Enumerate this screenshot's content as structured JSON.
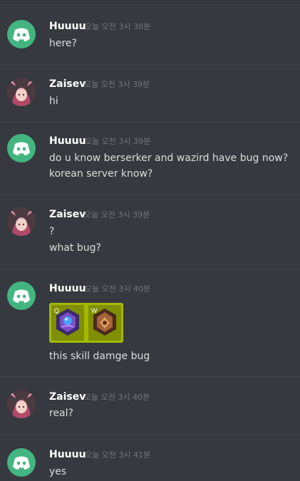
{
  "messages": [
    {
      "author": "Huuuu",
      "avatar": "discord-logo",
      "time": "오늘 오전 3시 38분",
      "lines": [
        "here?"
      ]
    },
    {
      "author": "Zaisev",
      "avatar": "character-portrait",
      "time": "오늘 오전 3시 39분",
      "lines": [
        "hi"
      ]
    },
    {
      "author": "Huuuu",
      "avatar": "discord-logo",
      "time": "오늘 오전 3시 39분",
      "lines": [
        "do u know berserker and wazird have bug now?",
        "korean server know?"
      ]
    },
    {
      "author": "Zaisev",
      "avatar": "character-portrait",
      "time": "오늘 오전 3시 39분",
      "lines": [
        "?",
        "what bug?"
      ]
    },
    {
      "author": "Huuuu",
      "avatar": "discord-logo",
      "time": "오늘 오전 3시 40분",
      "attachment": {
        "type": "image",
        "keys": [
          "Q",
          "W"
        ]
      },
      "lines": [
        "this skill damge bug"
      ]
    },
    {
      "author": "Zaisev",
      "avatar": "character-portrait",
      "time": "오늘 오전 3시 40분",
      "lines": [
        "real?"
      ]
    },
    {
      "author": "Huuuu",
      "avatar": "discord-logo",
      "time": "오늘 오전 3시 41분",
      "lines": [
        "yes"
      ]
    }
  ],
  "colors": {
    "background": "#36393f",
    "discord_green": "#43b581",
    "username": "#ffffff",
    "timestamp": "#72767d",
    "message_text": "#dcddde"
  }
}
